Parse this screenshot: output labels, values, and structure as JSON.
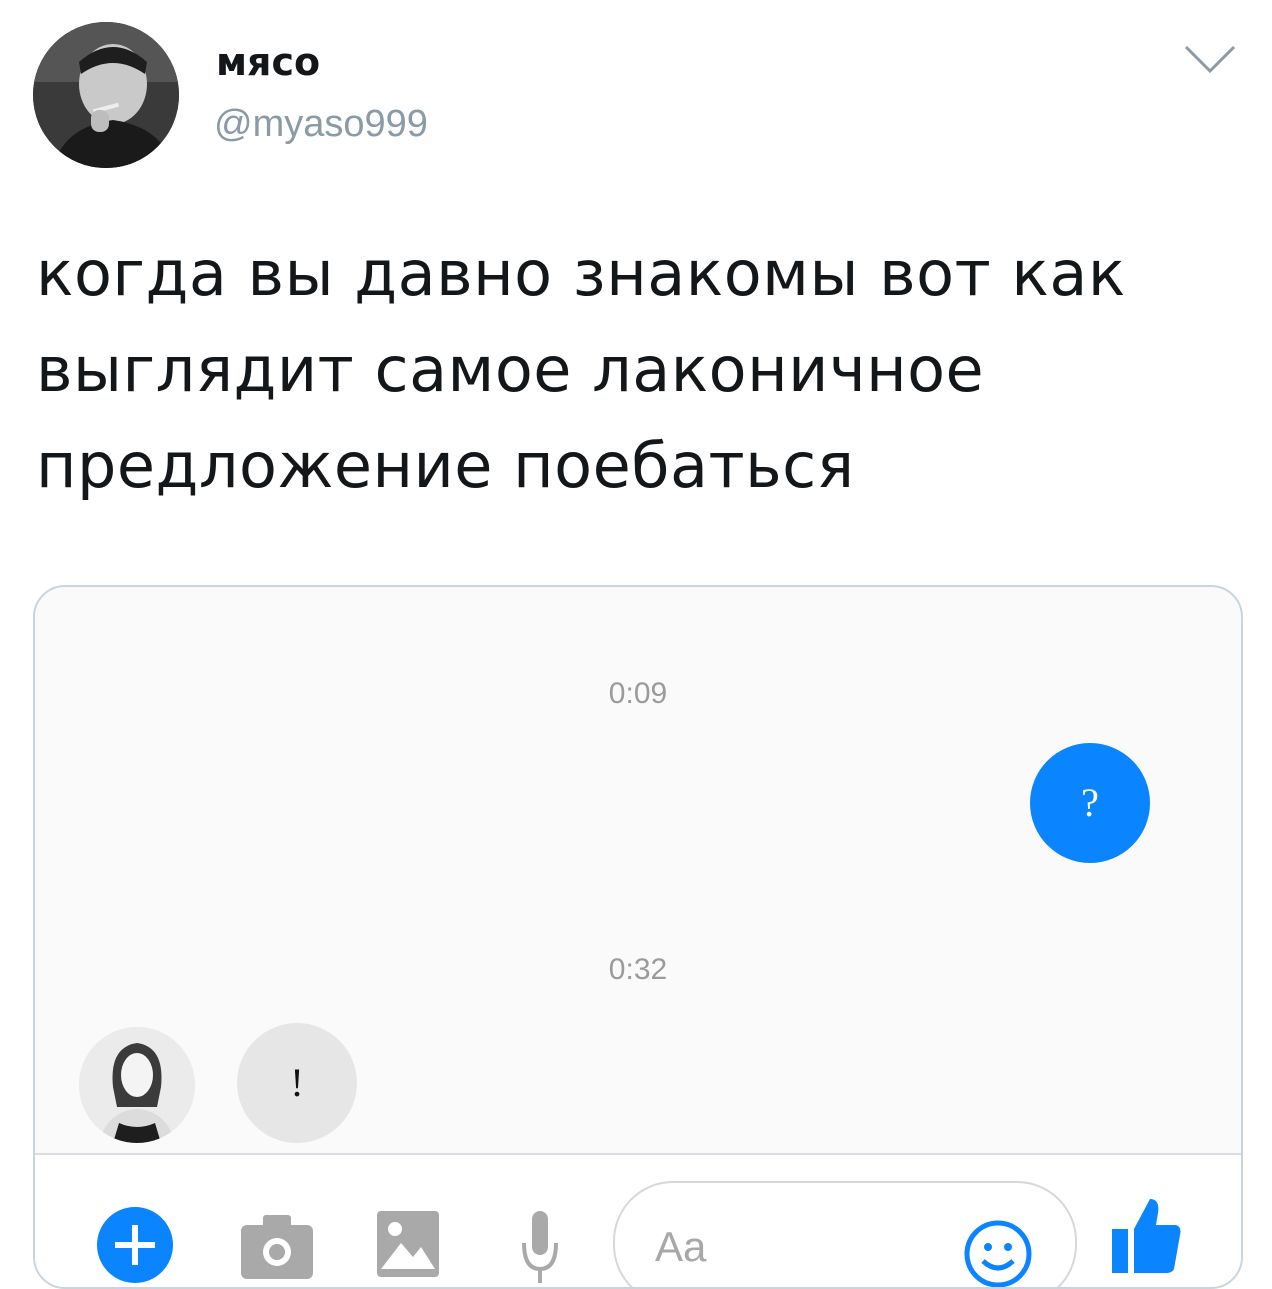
{
  "tweet": {
    "display_name": "мясо",
    "handle": "@myaso999",
    "text_lines": [
      "когда вы давно знакомы вот как",
      "выглядит самое лаконичное",
      "предложение поебаться"
    ]
  },
  "chat": {
    "messages": [
      {
        "timestamp": "0:09",
        "direction": "outgoing",
        "text": "?"
      },
      {
        "timestamp": "0:32",
        "direction": "incoming",
        "text": "!"
      }
    ],
    "composer": {
      "placeholder": "Aa",
      "icons": [
        "plus-icon",
        "camera-icon",
        "gallery-icon",
        "microphone-icon",
        "emoji-icon",
        "thumbs-up-icon"
      ]
    }
  },
  "colors": {
    "accent": "#0a84ff",
    "handle": "#8a9aa6",
    "incoming_bubble": "#e6e6e6",
    "card_border": "#c9d4de"
  }
}
